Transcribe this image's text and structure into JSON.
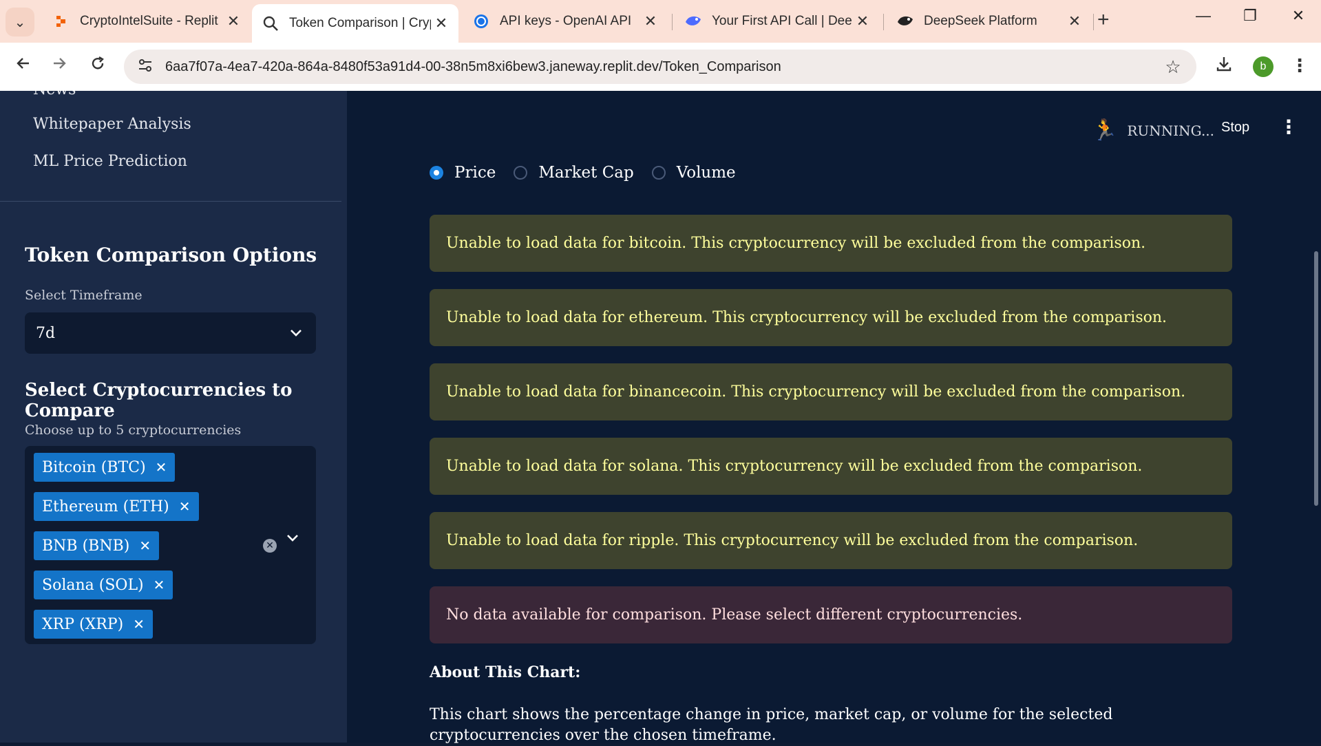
{
  "browser": {
    "tabs": [
      {
        "title": "CryptoIntelSuite - Replit",
        "icon": "replit-icon"
      },
      {
        "title": "Token Comparison | Cryp",
        "icon": "search-icon",
        "active": true
      },
      {
        "title": "API keys - OpenAI API",
        "icon": "openai-icon"
      },
      {
        "title": "Your First API Call | Deep",
        "icon": "deepseek-icon"
      },
      {
        "title": "DeepSeek Platform",
        "icon": "deepseek-icon"
      }
    ],
    "url": "6aa7f07a-4ea7-420a-864a-8480f53a91d4-00-38n5m8xi6bew3.janeway.replit.dev/Token_Comparison",
    "profile_initial": "b"
  },
  "sidebar": {
    "nav_items": [
      "News",
      "Whitepaper Analysis",
      "ML Price Prediction"
    ],
    "options_title": "Token Comparison Options",
    "timeframe_label": "Select Timeframe",
    "timeframe_value": "7d",
    "compare_title": "Select Cryptocurrencies to Compare",
    "compare_hint": "Choose up to 5 cryptocurrencies",
    "selected": [
      "Bitcoin (BTC)",
      "Ethereum (ETH)",
      "BNB (BNB)",
      "Solana (SOL)",
      "XRP (XRP)"
    ]
  },
  "header": {
    "status": "RUNNING...",
    "stop_label": "Stop"
  },
  "main": {
    "metric_options": [
      "Price",
      "Market Cap",
      "Volume"
    ],
    "selected_metric": "Price",
    "warnings": [
      "Unable to load data for bitcoin. This cryptocurrency will be excluded from the comparison.",
      "Unable to load data for ethereum. This cryptocurrency will be excluded from the comparison.",
      "Unable to load data for binancecoin. This cryptocurrency will be excluded from the comparison.",
      "Unable to load data for solana. This cryptocurrency will be excluded from the comparison.",
      "Unable to load data for ripple. This cryptocurrency will be excluded from the comparison."
    ],
    "error": "No data available for comparison. Please select different cryptocurrencies.",
    "about_title": "About This Chart:",
    "about_text": "This chart shows the percentage change in price, market cap, or volume for the selected cryptocurrencies over the chosen timeframe."
  },
  "colors": {
    "accent": "#1c83e1",
    "chip": "#1474c8",
    "warning_bg": "#3e432e",
    "error_bg": "#3a2738"
  }
}
